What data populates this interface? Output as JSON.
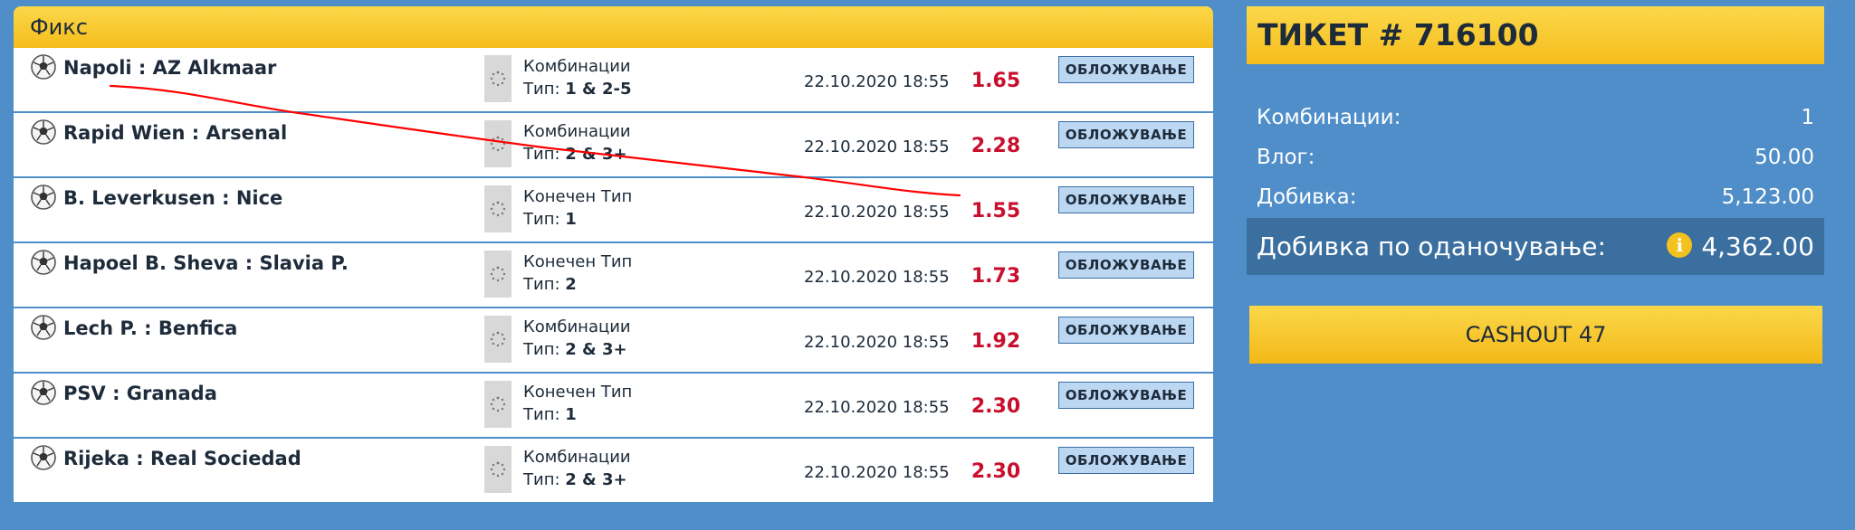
{
  "section": {
    "title": "Фикс"
  },
  "bet_button_label": "ОБЛОЖУВАЊЕ",
  "rows": [
    {
      "match": "Napoli : AZ Alkmaar",
      "type_name": "Комбинации",
      "type_prefix": "Тип: ",
      "type_value": "1 & 2-5",
      "datetime": "22.10.2020 18:55",
      "odds": "1.65"
    },
    {
      "match": "Rapid Wien : Arsenal",
      "type_name": "Комбинации",
      "type_prefix": "Тип: ",
      "type_value": "2 & 3+",
      "datetime": "22.10.2020 18:55",
      "odds": "2.28"
    },
    {
      "match": "B. Leverkusen : Nice",
      "type_name": "Конечен Тип",
      "type_prefix": "Тип: ",
      "type_value": "1",
      "datetime": "22.10.2020 18:55",
      "odds": "1.55"
    },
    {
      "match": "Hapoel B. Sheva : Slavia P.",
      "type_name": "Конечен Тип",
      "type_prefix": "Тип: ",
      "type_value": "2",
      "datetime": "22.10.2020 18:55",
      "odds": "1.73"
    },
    {
      "match": "Lech P. : Benfica",
      "type_name": "Комбинации",
      "type_prefix": "Тип: ",
      "type_value": "2 & 3+",
      "datetime": "22.10.2020 18:55",
      "odds": "1.92"
    },
    {
      "match": "PSV : Granada",
      "type_name": "Конечен Тип",
      "type_prefix": "Тип: ",
      "type_value": "1",
      "datetime": "22.10.2020 18:55",
      "odds": "2.30"
    },
    {
      "match": "Rijeka : Real Sociedad",
      "type_name": "Комбинации",
      "type_prefix": "Тип: ",
      "type_value": "2 & 3+",
      "datetime": "22.10.2020 18:55",
      "odds": "2.30"
    }
  ],
  "ticket": {
    "title": "ТИКЕТ # 716100",
    "combinations_label": "Комбинации:",
    "combinations_value": "1",
    "stake_label": "Влог:",
    "stake_value": "50.00",
    "win_label": "Добивка:",
    "win_value": "5,123.00",
    "tax_win_label": "Добивка по оданочување:",
    "tax_win_value": "4,362.00",
    "info_icon": "i",
    "cashout_label": "CASHOUT 47"
  },
  "colors": {
    "background": "#4f8ec8",
    "header": "#f5bd1c",
    "odds": "#c8102e",
    "strike": "#ff0000"
  }
}
